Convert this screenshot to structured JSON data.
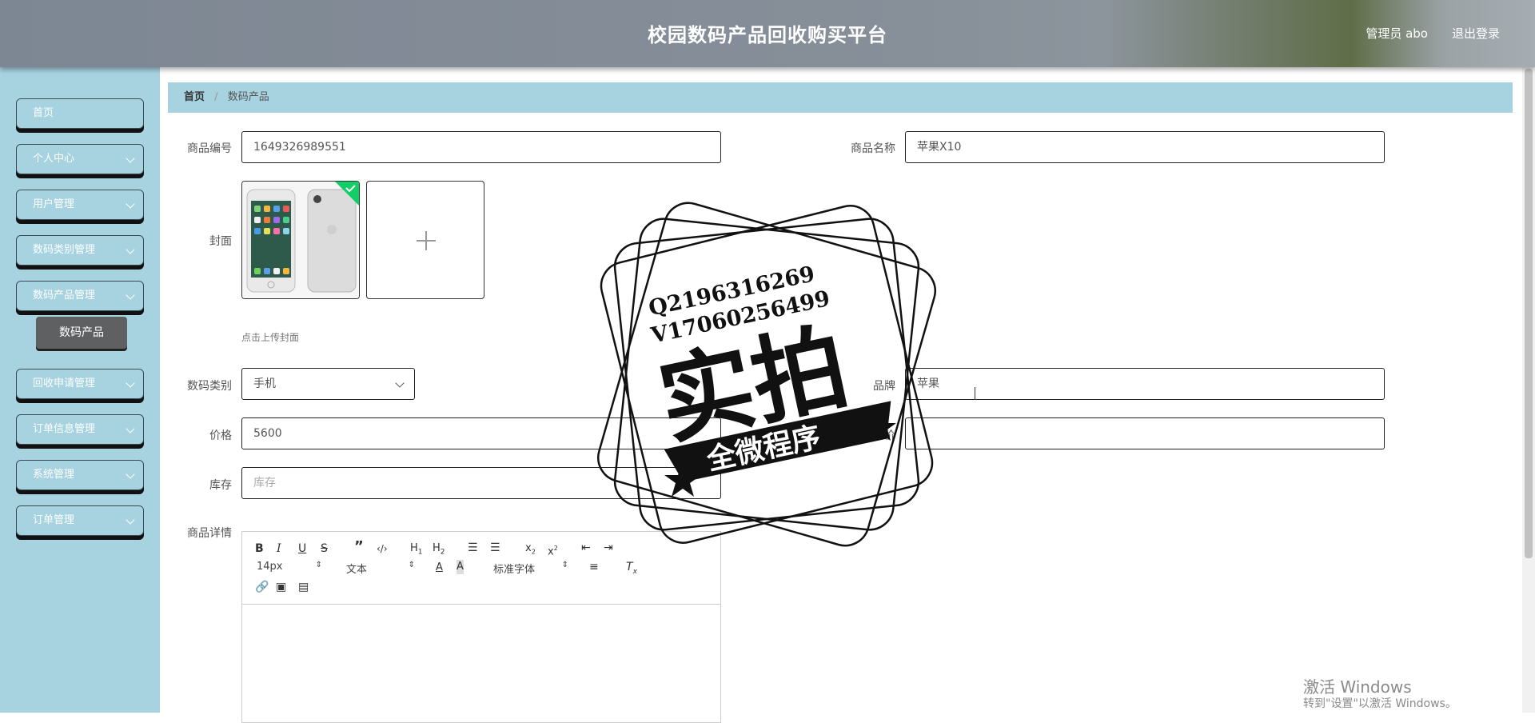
{
  "header": {
    "title": "校园数码产品回收购买平台",
    "user": "管理员 abo",
    "logout": "退出登录"
  },
  "sidebar": {
    "items": [
      {
        "label": "首页"
      },
      {
        "label": "个人中心"
      },
      {
        "label": "用户管理"
      },
      {
        "label": "数码类别管理"
      },
      {
        "label": "数码产品管理"
      },
      {
        "label": "回收申请管理"
      },
      {
        "label": "订单信息管理"
      },
      {
        "label": "系统管理"
      },
      {
        "label": "订单管理"
      }
    ],
    "submenu": {
      "label": "数码产品"
    }
  },
  "breadcrumb": {
    "home": "首页",
    "separator": "/",
    "current": "数码产品"
  },
  "form": {
    "product_id": {
      "label": "商品编号",
      "value": "1649326989551"
    },
    "product_name": {
      "label": "商品名称",
      "value": "苹果X10"
    },
    "cover": {
      "label": "封面",
      "hint": "点击上传封面"
    },
    "category": {
      "label": "数码类别",
      "value": "手机"
    },
    "brand": {
      "label": "品牌",
      "value": "苹果"
    },
    "price": {
      "label": "价格",
      "value": "5600"
    },
    "unit_price": {
      "label": "单价",
      "value": ""
    },
    "stock": {
      "label": "库存",
      "placeholder": "库存"
    },
    "detail": {
      "label": "商品详情"
    }
  },
  "editor": {
    "font_size": "14px",
    "format": "文本",
    "font_family": "标准字体"
  },
  "watermark": {
    "line1": "Q2196316269",
    "line2": "V17060256499",
    "big": "实拍",
    "ribbon": "全微程序"
  },
  "windows": {
    "line1": "激活 Windows",
    "line2": "转到\"设置\"以激活 Windows。"
  }
}
